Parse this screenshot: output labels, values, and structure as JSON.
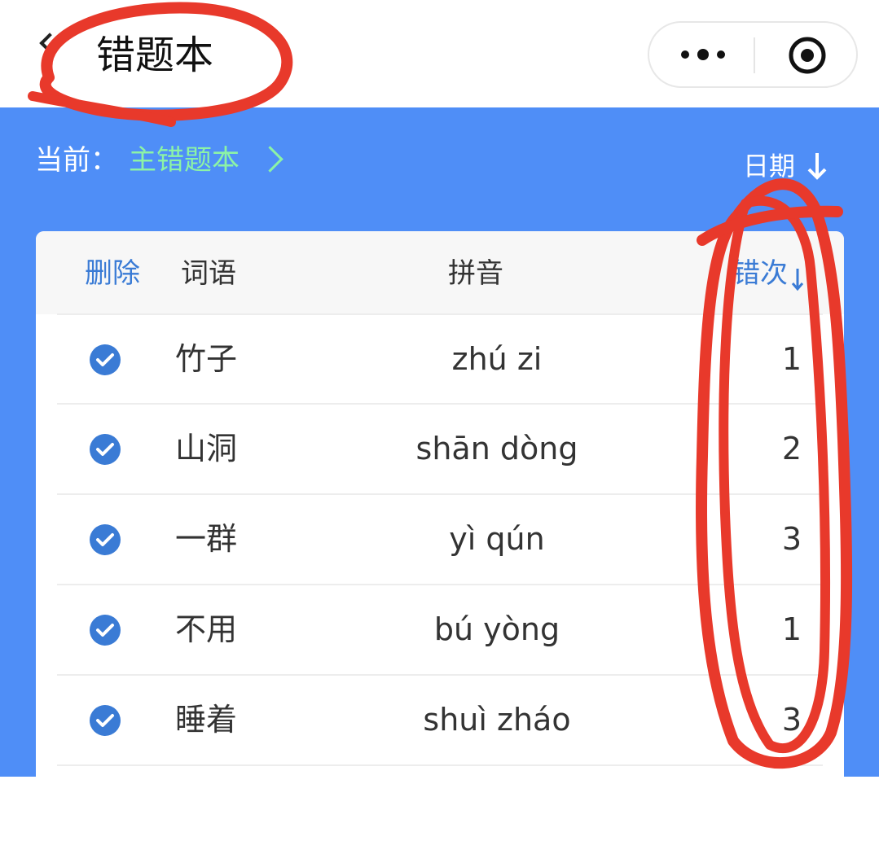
{
  "header": {
    "title": "错题本",
    "back_icon": "chevron-left-icon",
    "capsule": {
      "more_icon": "more-dots-icon",
      "close_icon": "target-circle-icon"
    }
  },
  "toolbar": {
    "current_label": "当前：",
    "current_value": "主错题本",
    "sort_label": "日期"
  },
  "table": {
    "headers": {
      "delete": "删除",
      "word": "词语",
      "pinyin": "拼音",
      "count": "错次"
    },
    "rows": [
      {
        "word": "竹子",
        "pinyin": "zhú zi",
        "count": "1",
        "checked": true
      },
      {
        "word": "山洞",
        "pinyin": "shān dòng",
        "count": "2",
        "checked": true
      },
      {
        "word": "一群",
        "pinyin": "yì qún",
        "count": "3",
        "checked": true
      },
      {
        "word": "不用",
        "pinyin": "bú yòng",
        "count": "1",
        "checked": true
      },
      {
        "word": "睡着",
        "pinyin": "shuì zháo",
        "count": "3",
        "checked": true
      }
    ]
  },
  "colors": {
    "blue_background": "#4f8ef7",
    "accent_green": "#8cf3a6",
    "check_blue": "#3a7bd5",
    "annotation_red": "#e8392b"
  }
}
